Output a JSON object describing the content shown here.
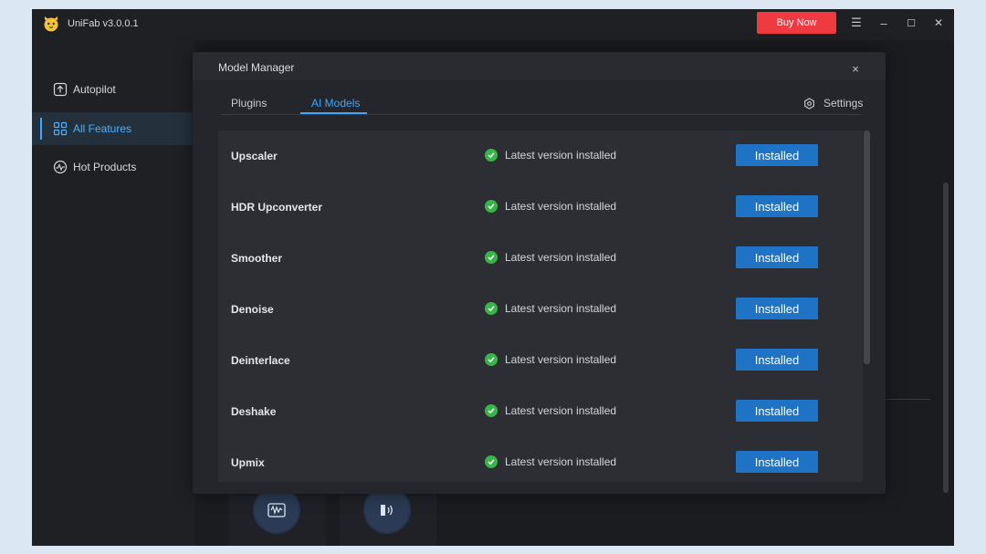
{
  "app": {
    "title": "UniFab v3.0.0.1",
    "buy_label": "Buy Now"
  },
  "window_controls": {
    "menu": "☰",
    "minimize": "–",
    "maximize": "☐",
    "close": "✕"
  },
  "sidebar": {
    "items": [
      {
        "label": "Autopilot",
        "icon": "autopilot-icon",
        "active": false
      },
      {
        "label": "All Features",
        "icon": "grid-icon",
        "active": true
      },
      {
        "label": "Hot Products",
        "icon": "hot-products-icon",
        "active": false
      }
    ]
  },
  "modal": {
    "title": "Model Manager",
    "close": "×",
    "tabs": [
      {
        "label": "Plugins",
        "active": false
      },
      {
        "label": "AI Models",
        "active": true
      }
    ],
    "settings_label": "Settings",
    "rows": [
      {
        "name": "Upscaler",
        "status": "Latest version installed",
        "button": "Installed"
      },
      {
        "name": "HDR Upconverter",
        "status": "Latest version installed",
        "button": "Installed"
      },
      {
        "name": "Smoother",
        "status": "Latest version installed",
        "button": "Installed"
      },
      {
        "name": "Denoise",
        "status": "Latest version installed",
        "button": "Installed"
      },
      {
        "name": "Deinterlace",
        "status": "Latest version installed",
        "button": "Installed"
      },
      {
        "name": "Deshake",
        "status": "Latest version installed",
        "button": "Installed"
      },
      {
        "name": "Upmix",
        "status": "Latest version installed",
        "button": "Installed"
      }
    ]
  },
  "colors": {
    "accent": "#3ea6ff",
    "buy": "#ef3b3f",
    "installed_button": "#1e73c4",
    "check": "#38b54a"
  }
}
